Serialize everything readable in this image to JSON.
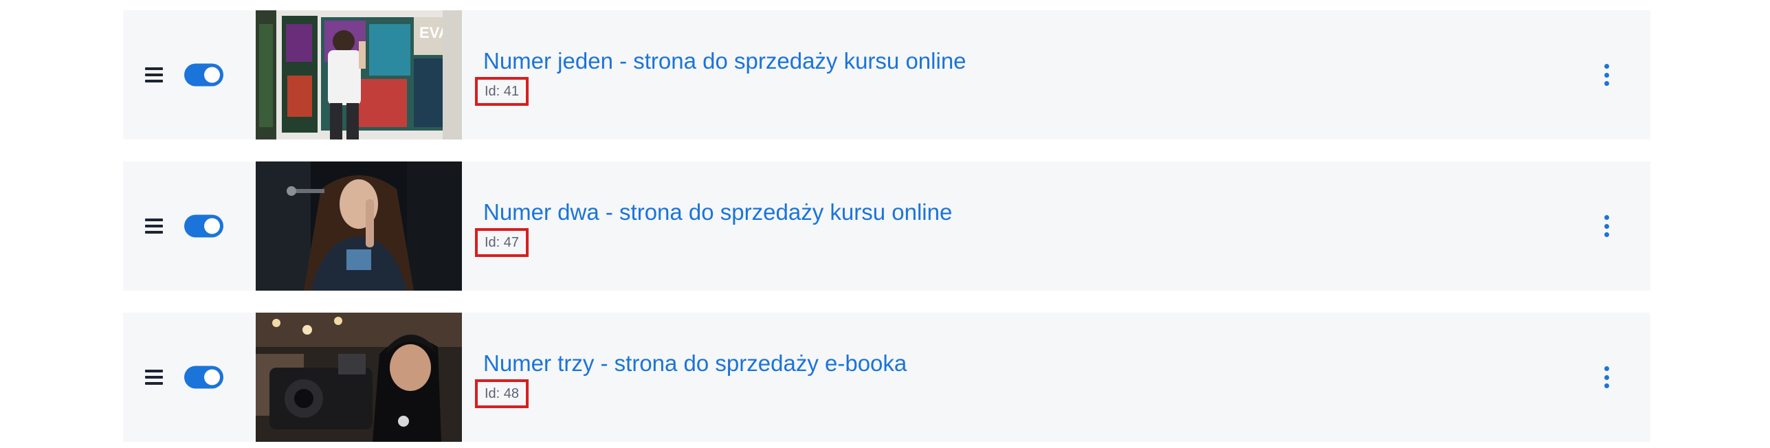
{
  "colors": {
    "accent": "#1a74d9",
    "row_background": "#f6f7f9",
    "highlight_border": "#d71f1f",
    "id_text": "#5b6270"
  },
  "icons": {
    "drag": "drag-handle-icon",
    "toggle": "toggle-switch",
    "menu": "kebab-menu-icon"
  },
  "pages": [
    {
      "title": "Numer jeden - strona do sprzedaży kursu online",
      "id_label": "Id: 41",
      "enabled": true,
      "thumbnail": "graffiti-artist-painting-wall"
    },
    {
      "title": "Numer dwa - strona do sprzedaży kursu online",
      "id_label": "Id: 47",
      "enabled": true,
      "thumbnail": "woman-singing-microphone"
    },
    {
      "title": "Numer trzy - strona do sprzedaży e-booka",
      "id_label": "Id: 48",
      "enabled": true,
      "thumbnail": "man-with-video-camera"
    }
  ]
}
